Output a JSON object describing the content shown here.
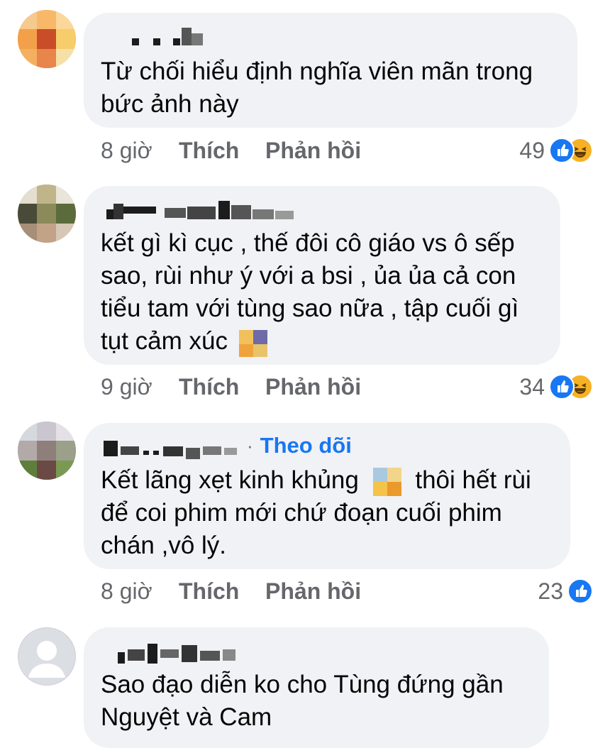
{
  "comments": [
    {
      "text_lines": [
        "Từ chối hiểu định nghĩa viên mãn trong",
        "bức ảnh này"
      ],
      "time": "8 giờ",
      "like": "Thích",
      "reply": "Phản hồi",
      "reactions": "49",
      "reaction_icons": [
        "like-icon",
        "haha-icon"
      ]
    },
    {
      "text_lines": [
        "kết gì kì cục , thế đôi cô giáo vs ô sếp",
        "sao, rùi như ý với a bsi , ủa ủa cả con",
        "tiểu tam với tùng sao nữa , tập cuối gì",
        "tụt cảm xúc"
      ],
      "time": "9 giờ",
      "like": "Thích",
      "reply": "Phản hồi",
      "reactions": "34",
      "reaction_icons": [
        "like-icon",
        "haha-icon"
      ]
    },
    {
      "follow_sep": "·",
      "follow": "Theo dõi",
      "line1_a": "Kết lãng xẹt kinh khủng",
      "line1_b": "thôi hết rùi",
      "text_lines": [
        "để coi phim mới chứ đoạn cuối phim",
        "chán ,vô lý."
      ],
      "time": "8 giờ",
      "like": "Thích",
      "reply": "Phản hồi",
      "reactions": "23",
      "reaction_icons": [
        "like-icon"
      ]
    },
    {
      "text_lines": [
        "Sao đạo diễn ko cho Tùng đứng gần",
        "Nguyệt và Cam"
      ]
    }
  ],
  "colors": {
    "bubble": "#f0f2f5",
    "link": "#1877f2",
    "muted": "#65676b",
    "like": "#1877f2",
    "haha": "#f7b125"
  }
}
